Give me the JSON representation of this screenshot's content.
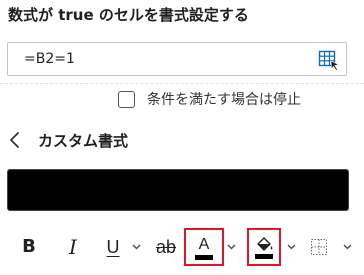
{
  "header": {
    "title": "数式が true のセルを書式設定する"
  },
  "formula": {
    "value": "=B2=1",
    "range_icon": "range-select-icon"
  },
  "stop_if_true": {
    "label": "条件を満たす場合は停止",
    "checked": false
  },
  "custom_format": {
    "back_icon": "chevron-left-icon",
    "title": "カスタム書式"
  },
  "preview": {
    "fill_color": "#000000"
  },
  "toolbar": {
    "bold_label": "B",
    "italic_label": "I",
    "underline_label": "U",
    "strike_label": "ab",
    "font_color_label": "A",
    "font_color_swatch": "#000000",
    "fill_color_swatch": "#000000",
    "highlight_color": "#e0142a",
    "icons": [
      "bold-icon",
      "italic-icon",
      "underline-icon",
      "underline-dropdown-icon",
      "strikethrough-icon",
      "font-color-icon",
      "font-color-dropdown-icon",
      "fill-color-icon",
      "fill-color-dropdown-icon",
      "borders-icon",
      "borders-dropdown-icon"
    ]
  }
}
